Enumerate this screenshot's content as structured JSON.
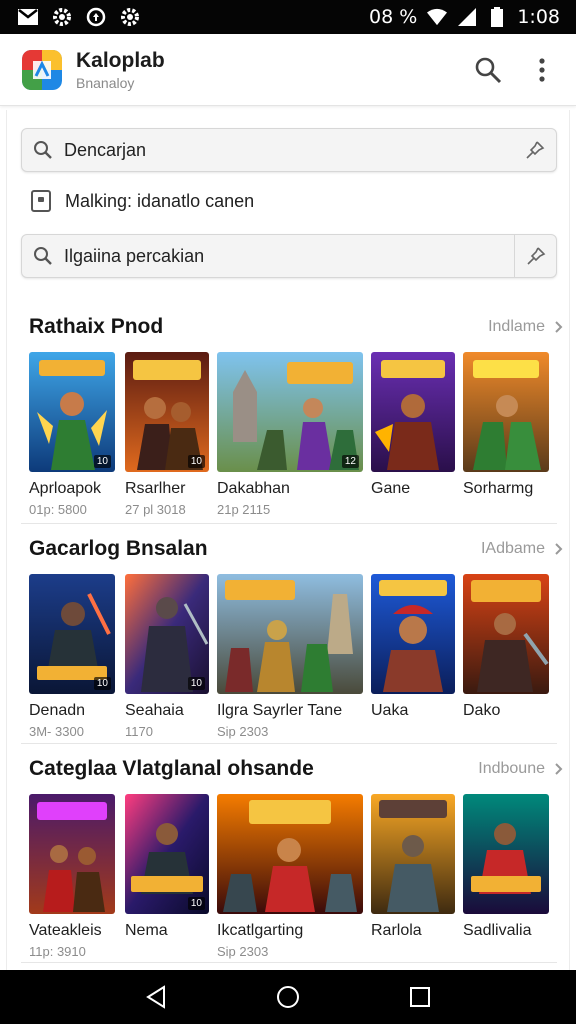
{
  "status_bar": {
    "time": "1:08",
    "network": "08 %",
    "icons": [
      "gmail-icon",
      "settings-icon",
      "sync-icon",
      "gear-icon",
      "wifi-icon",
      "signal-icon",
      "battery-icon"
    ]
  },
  "app_bar": {
    "title": "Kaloplab",
    "subtitle": "Bnanaloy",
    "actions": [
      "search-icon",
      "more-vert-icon"
    ]
  },
  "search_primary": {
    "value": "Dencarjan"
  },
  "checkbox_row": {
    "label": "Malking: idanatlo canen"
  },
  "search_secondary": {
    "value": "Ilgaiina percakian"
  },
  "sections": [
    {
      "title": "Rathaix Pnod",
      "more_label": "Indlame",
      "items": [
        {
          "name": "Aprloapok",
          "meta": "01p: 5800",
          "badge": "10"
        },
        {
          "name": "Rsarlher",
          "meta": "27 pl 3018",
          "badge": "10"
        },
        {
          "name": "Dakabhan",
          "meta": "21p 2115",
          "badge": "12"
        },
        {
          "name": "Gane",
          "meta": "",
          "badge": ""
        },
        {
          "name": "Sorharmg",
          "meta": "",
          "badge": ""
        }
      ]
    },
    {
      "title": "Gacarlog Bnsalan",
      "more_label": "IAdbame",
      "items": [
        {
          "name": "Denadn",
          "meta": "3M- 3300",
          "badge": "10"
        },
        {
          "name": "Seahaia",
          "meta": "1170",
          "badge": "10"
        },
        {
          "name": "Ilgra Sayrler Tane",
          "meta": "Sip 2303",
          "badge": ""
        },
        {
          "name": "Uaka",
          "meta": "",
          "badge": ""
        },
        {
          "name": "Dako",
          "meta": "",
          "badge": ""
        }
      ]
    },
    {
      "title": "Categlaa Vlatglanal ohsande",
      "more_label": "Indboune",
      "items": [
        {
          "name": "Vateakleis",
          "meta": "11p: 3910",
          "badge": ""
        },
        {
          "name": "Nema",
          "meta": "",
          "badge": "10"
        },
        {
          "name": "Ikcatlgarting",
          "meta": "Sip 2303",
          "badge": ""
        },
        {
          "name": "Rarlola",
          "meta": "",
          "badge": ""
        },
        {
          "name": "Sadlivalia",
          "meta": "",
          "badge": ""
        }
      ]
    }
  ],
  "colors": {
    "status_bar": "#050505",
    "nav_bar": "#000000",
    "accent_red": "#e53935",
    "accent_green": "#43a047",
    "accent_blue": "#1e88e5"
  },
  "nav_bar": {
    "buttons": [
      "back-icon",
      "home-icon",
      "recents-icon"
    ]
  }
}
